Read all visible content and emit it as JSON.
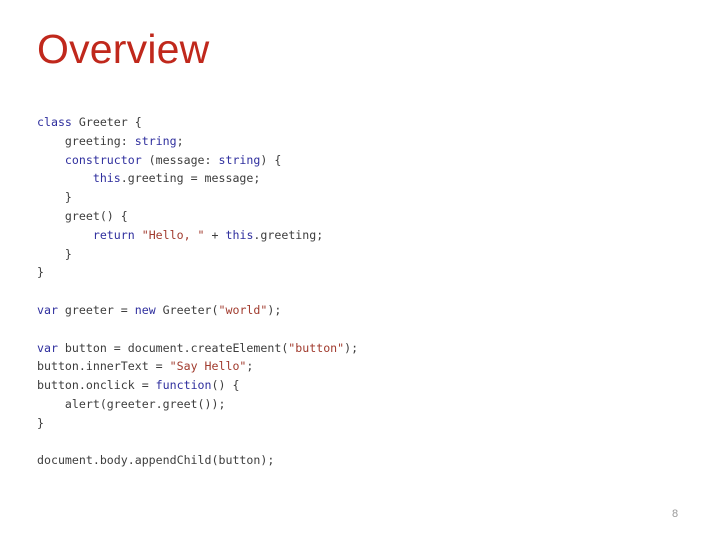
{
  "slide": {
    "title": "Overview",
    "title_color": "#C0281C",
    "background_color": "#ffffff",
    "page_number": "8"
  },
  "theme": {
    "keyword_color": "#2F2F9E",
    "string_color": "#A13B2E",
    "plain_color": "#3d3d3d",
    "page_number_color": "#9a9a9a"
  },
  "code": {
    "language": "typescript",
    "plain_text": "class Greeter {\n    greeting: string;\n    constructor (message: string) {\n        this.greeting = message;\n    }\n    greet() {\n        return \"Hello, \" + this.greeting;\n    }\n}\n\nvar greeter = new Greeter(\"world\");\n\nvar button = document.createElement(\"button\");\nbutton.innerText = \"Say Hello\";\nbutton.onclick = function() {\n    alert(greeter.greet());\n}\n\ndocument.body.appendChild(button);",
    "lines": [
      {
        "indent": 0,
        "tokens": [
          {
            "t": "class",
            "k": "kw"
          },
          {
            "t": " Greeter {",
            "k": "plain"
          }
        ]
      },
      {
        "indent": 1,
        "tokens": [
          {
            "t": "greeting: ",
            "k": "plain"
          },
          {
            "t": "string",
            "k": "type"
          },
          {
            "t": ";",
            "k": "plain"
          }
        ]
      },
      {
        "indent": 1,
        "tokens": [
          {
            "t": "constructor",
            "k": "kw"
          },
          {
            "t": " (message: ",
            "k": "plain"
          },
          {
            "t": "string",
            "k": "type"
          },
          {
            "t": ") {",
            "k": "plain"
          }
        ]
      },
      {
        "indent": 2,
        "tokens": [
          {
            "t": "this",
            "k": "kw"
          },
          {
            "t": ".greeting = message;",
            "k": "plain"
          }
        ]
      },
      {
        "indent": 1,
        "tokens": [
          {
            "t": "}",
            "k": "plain"
          }
        ]
      },
      {
        "indent": 1,
        "tokens": [
          {
            "t": "greet() {",
            "k": "plain"
          }
        ]
      },
      {
        "indent": 2,
        "tokens": [
          {
            "t": "return",
            "k": "kw"
          },
          {
            "t": " ",
            "k": "plain"
          },
          {
            "t": "\"Hello, \"",
            "k": "str"
          },
          {
            "t": " + ",
            "k": "plain"
          },
          {
            "t": "this",
            "k": "kw"
          },
          {
            "t": ".greeting;",
            "k": "plain"
          }
        ]
      },
      {
        "indent": 1,
        "tokens": [
          {
            "t": "}",
            "k": "plain"
          }
        ]
      },
      {
        "indent": 0,
        "tokens": [
          {
            "t": "}",
            "k": "plain"
          }
        ]
      },
      {
        "indent": 0,
        "tokens": []
      },
      {
        "indent": 0,
        "tokens": [
          {
            "t": "var",
            "k": "kw"
          },
          {
            "t": " greeter = ",
            "k": "plain"
          },
          {
            "t": "new",
            "k": "kw"
          },
          {
            "t": " Greeter(",
            "k": "plain"
          },
          {
            "t": "\"world\"",
            "k": "str"
          },
          {
            "t": ");",
            "k": "plain"
          }
        ]
      },
      {
        "indent": 0,
        "tokens": []
      },
      {
        "indent": 0,
        "tokens": [
          {
            "t": "var",
            "k": "kw"
          },
          {
            "t": " button = document.createElement(",
            "k": "plain"
          },
          {
            "t": "\"button\"",
            "k": "str"
          },
          {
            "t": ");",
            "k": "plain"
          }
        ]
      },
      {
        "indent": 0,
        "tokens": [
          {
            "t": "button.innerText = ",
            "k": "plain"
          },
          {
            "t": "\"Say Hello\"",
            "k": "str"
          },
          {
            "t": ";",
            "k": "plain"
          }
        ]
      },
      {
        "indent": 0,
        "tokens": [
          {
            "t": "button.onclick = ",
            "k": "plain"
          },
          {
            "t": "function",
            "k": "kw"
          },
          {
            "t": "() {",
            "k": "plain"
          }
        ]
      },
      {
        "indent": 1,
        "tokens": [
          {
            "t": "alert(greeter.greet());",
            "k": "plain"
          }
        ]
      },
      {
        "indent": 0,
        "tokens": [
          {
            "t": "}",
            "k": "plain"
          }
        ]
      },
      {
        "indent": 0,
        "tokens": []
      },
      {
        "indent": 0,
        "tokens": [
          {
            "t": "document.body.appendChild(button);",
            "k": "plain"
          }
        ]
      }
    ]
  }
}
